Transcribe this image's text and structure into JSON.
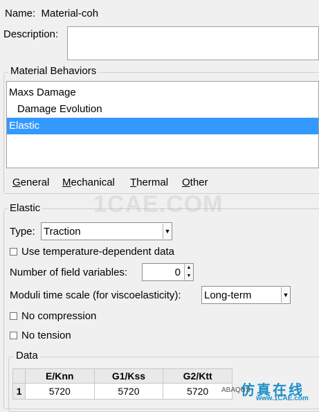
{
  "name": {
    "label": "Name:",
    "value": "Material-coh"
  },
  "description": {
    "label": "Description:",
    "value": ""
  },
  "behaviors": {
    "title": "Material Behaviors",
    "items": [
      {
        "label": "Maxs Damage"
      },
      {
        "label": "Damage Evolution"
      },
      {
        "label": "Elastic"
      }
    ],
    "selected": "Elastic"
  },
  "menu": {
    "general": {
      "first": "G",
      "rest": "eneral"
    },
    "mechanical": {
      "first": "M",
      "rest": "echanical"
    },
    "thermal": {
      "first": "T",
      "rest": "hermal"
    },
    "other": {
      "first": "O",
      "rest": "ther"
    }
  },
  "elastic": {
    "title": "Elastic",
    "type_label": "Type:",
    "type_value": "Traction",
    "temp_dependent_label": "Use temperature-dependent data",
    "field_vars_label": "Number of field variables:",
    "field_vars_value": "0",
    "moduli_label": "Moduli time scale (for viscoelasticity):",
    "moduli_value": "Long-term",
    "no_compression_label": "No compression",
    "no_tension_label": "No tension"
  },
  "data_table": {
    "title": "Data",
    "columns": [
      "E/Knn",
      "G1/Kss",
      "G2/Ktt"
    ],
    "rows": [
      {
        "index": "1",
        "values": [
          "5720",
          "5720",
          "5720"
        ]
      }
    ]
  },
  "watermarks": {
    "center": "1CAE.COM",
    "cn": "仿真在线",
    "small_left": "ABAQUS",
    "small_right": "www.1CAE.com"
  }
}
